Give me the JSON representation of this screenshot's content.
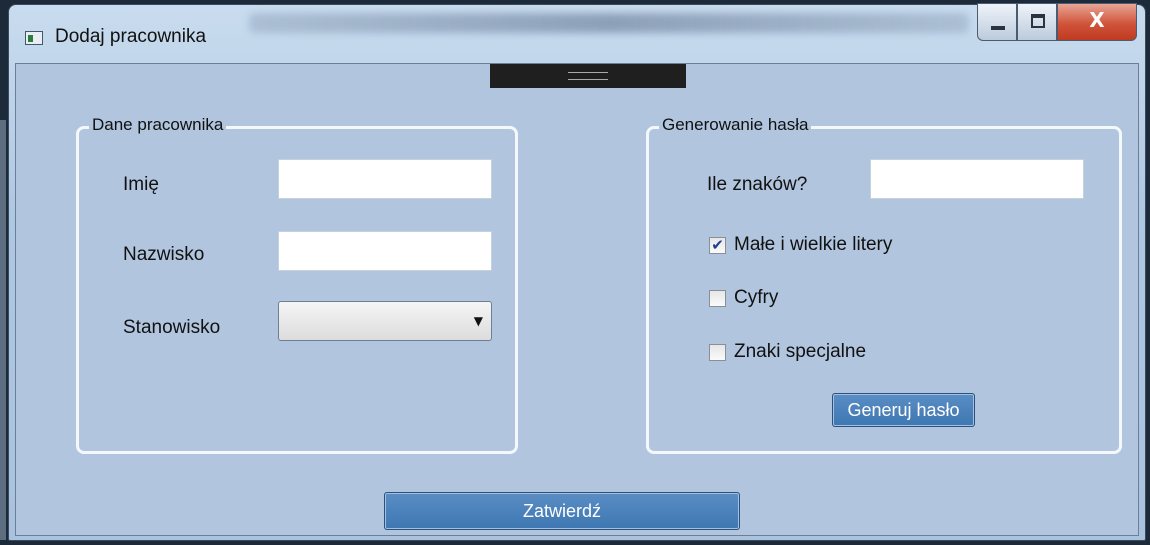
{
  "window": {
    "title": "Dodaj pracownika",
    "icon": "app-window-icon",
    "caption": {
      "minimize_icon": "minimize-icon",
      "maximize_icon": "maximize-icon",
      "close_glyph": "X"
    }
  },
  "employee_group": {
    "legend": "Dane pracownika",
    "first_name_label": "Imię",
    "first_name_value": "",
    "last_name_label": "Nazwisko",
    "last_name_value": "",
    "position_label": "Stanowisko",
    "position_selected": "",
    "position_arrow": "▼"
  },
  "password_group": {
    "legend": "Generowanie hasła",
    "length_label": "Ile znaków?",
    "length_value": "",
    "checkboxes": [
      {
        "label": "Małe i wielkie litery",
        "checked": true,
        "mark": "✔"
      },
      {
        "label": "Cyfry",
        "checked": false,
        "mark": ""
      },
      {
        "label": "Znaki specjalne",
        "checked": false,
        "mark": ""
      }
    ],
    "generate_button": "Generuj hasło"
  },
  "submit_button": "Zatwierdź",
  "colors": {
    "client_bg": "#b1c5de",
    "button_blue": "#4a82bc",
    "close_red": "#c8452b"
  }
}
